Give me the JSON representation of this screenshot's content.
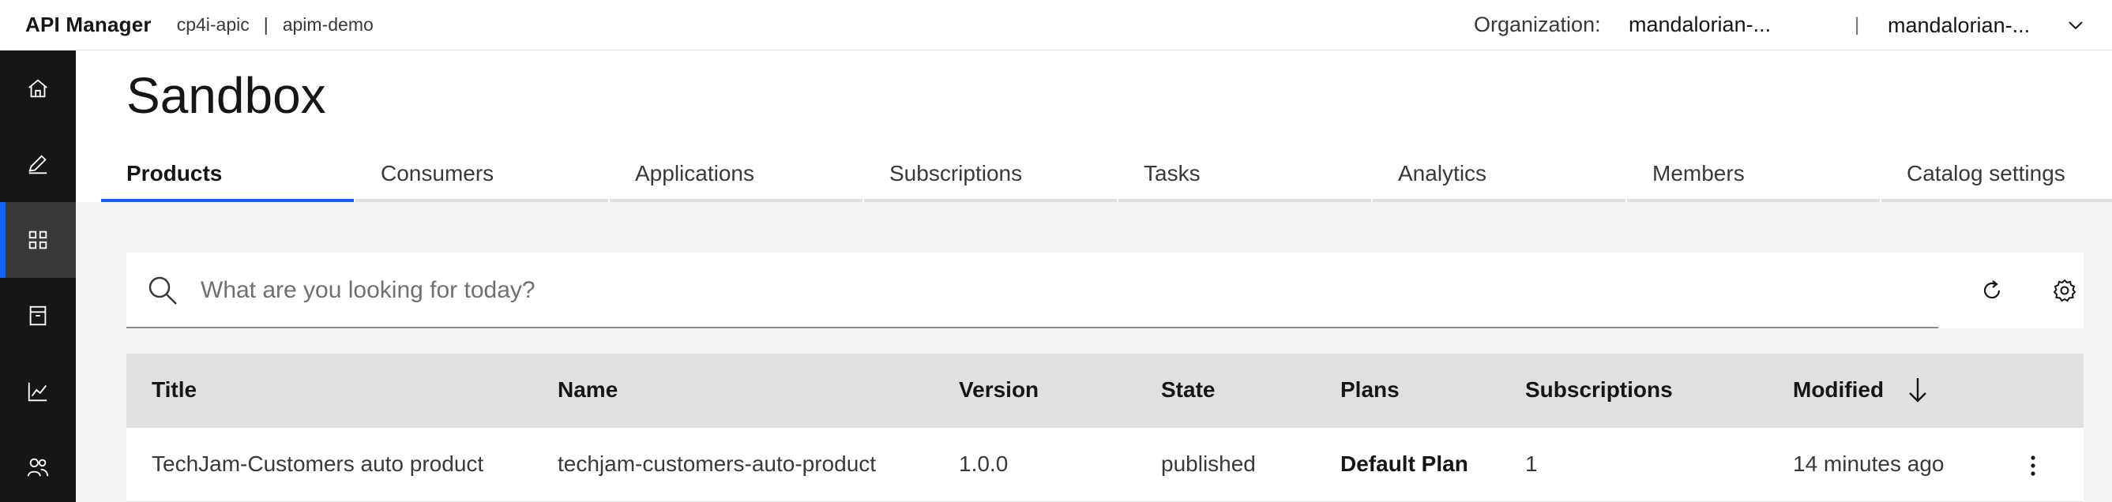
{
  "header": {
    "app_name": "API Manager",
    "breadcrumb": [
      "cp4i-apic",
      "apim-demo"
    ],
    "breadcrumb_separator": "|",
    "org_label": "Organization:",
    "org_value": "mandalorian-...",
    "separator": "|",
    "user_value": "mandalorian-..."
  },
  "rail": {
    "items": [
      {
        "name": "home",
        "icon": "home-icon"
      },
      {
        "name": "develop",
        "icon": "edit-icon"
      },
      {
        "name": "manage",
        "icon": "apps-grid-icon",
        "active": true
      },
      {
        "name": "resources",
        "icon": "archive-icon"
      },
      {
        "name": "analytics",
        "icon": "chart-line-icon"
      },
      {
        "name": "members",
        "icon": "user-group-icon"
      }
    ]
  },
  "page": {
    "title": "Sandbox"
  },
  "tabs": [
    {
      "label": "Products",
      "active": true
    },
    {
      "label": "Consumers"
    },
    {
      "label": "Applications"
    },
    {
      "label": "Subscriptions"
    },
    {
      "label": "Tasks"
    },
    {
      "label": "Analytics"
    },
    {
      "label": "Members"
    },
    {
      "label": "Catalog settings"
    }
  ],
  "search": {
    "placeholder": "What are you looking for today?",
    "value": "",
    "refresh_icon": "refresh-icon",
    "settings_icon": "settings-icon"
  },
  "table": {
    "columns": [
      "Title",
      "Name",
      "Version",
      "State",
      "Plans",
      "Subscriptions",
      "Modified"
    ],
    "sort_column": "Modified",
    "sort_direction": "descending",
    "rows": [
      {
        "title": "TechJam-Customers auto product",
        "name": "techjam-customers-auto-product",
        "version": "1.0.0",
        "state": "published",
        "plans": "Default Plan",
        "subscriptions": "1",
        "modified": "14 minutes ago"
      }
    ]
  },
  "colors": {
    "accent": "#0f62fe",
    "rail_bg": "#161616",
    "rail_active": "#393939",
    "page_bg": "#f4f4f4",
    "table_header": "#e0e0e0"
  }
}
